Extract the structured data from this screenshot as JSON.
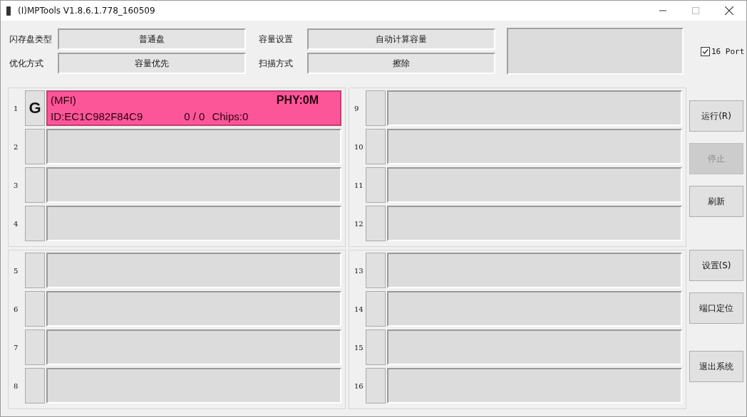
{
  "window": {
    "title": "(I)MPTools V1.8.6.1.778_160509"
  },
  "settings": [
    {
      "label": "闪存盘类型",
      "value": "普通盘"
    },
    {
      "label": "容量设置",
      "value": "自动计算容量"
    },
    {
      "label": "优化方式",
      "value": "容量优先"
    },
    {
      "label": "扫描方式",
      "value": "擦除"
    }
  ],
  "port16": {
    "label": "16 Port",
    "checked": true
  },
  "port_groups": [
    [
      {
        "number": "1",
        "active": true,
        "letter": "G",
        "model": "(MFI)",
        "phy": "PHY:0M",
        "id": "ID:EC1C982F84C9",
        "count": "0 / 0",
        "chips": "Chips:0"
      },
      {
        "number": "2",
        "active": false
      },
      {
        "number": "3",
        "active": false
      },
      {
        "number": "4",
        "active": false
      }
    ],
    [
      {
        "number": "9",
        "active": false
      },
      {
        "number": "10",
        "active": false
      },
      {
        "number": "11",
        "active": false
      },
      {
        "number": "12",
        "active": false
      }
    ],
    [
      {
        "number": "5",
        "active": false
      },
      {
        "number": "6",
        "active": false
      },
      {
        "number": "7",
        "active": false
      },
      {
        "number": "8",
        "active": false
      }
    ],
    [
      {
        "number": "13",
        "active": false
      },
      {
        "number": "14",
        "active": false
      },
      {
        "number": "15",
        "active": false
      },
      {
        "number": "16",
        "active": false
      }
    ]
  ],
  "buttons": [
    {
      "label": "运行(R)",
      "disabled": false
    },
    {
      "label": "停止",
      "disabled": true
    },
    {
      "label": "刷新",
      "disabled": false
    },
    {
      "label": "设置(S)",
      "disabled": false
    },
    {
      "label": "端口定位",
      "disabled": false
    },
    {
      "label": "退出系统",
      "disabled": false
    }
  ]
}
